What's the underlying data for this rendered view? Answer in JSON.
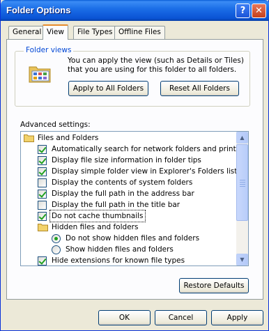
{
  "window": {
    "title": "Folder Options"
  },
  "titlebar": {
    "help_label": "?",
    "close_label": "✕"
  },
  "tabs": [
    {
      "label": "General"
    },
    {
      "label": "View"
    },
    {
      "label": "File Types"
    },
    {
      "label": "Offline Files"
    }
  ],
  "folder_views": {
    "legend": "Folder views",
    "description": "You can apply the view (such as Details or Tiles) that you are using for this folder to all folders.",
    "apply_label": "Apply to All Folders",
    "reset_label": "Reset All Folders"
  },
  "advanced": {
    "label": "Advanced settings:",
    "items": [
      {
        "type": "folder",
        "label": "Files and Folders"
      },
      {
        "type": "checkbox",
        "checked": true,
        "label": "Automatically search for network folders and printers"
      },
      {
        "type": "checkbox",
        "checked": true,
        "label": "Display file size information in folder tips"
      },
      {
        "type": "checkbox",
        "checked": true,
        "label": "Display simple folder view in Explorer's Folders list"
      },
      {
        "type": "checkbox",
        "checked": false,
        "label": "Display the contents of system folders"
      },
      {
        "type": "checkbox",
        "checked": true,
        "label": "Display the full path in the address bar"
      },
      {
        "type": "checkbox",
        "checked": false,
        "label": "Display the full path in the title bar"
      },
      {
        "type": "checkbox",
        "checked": true,
        "label": "Do not cache thumbnails",
        "selected": true
      },
      {
        "type": "folder",
        "label": "Hidden files and folders"
      },
      {
        "type": "radio",
        "checked": true,
        "label": "Do not show hidden files and folders"
      },
      {
        "type": "radio",
        "checked": false,
        "label": "Show hidden files and folders"
      },
      {
        "type": "checkbox",
        "checked": true,
        "label": "Hide extensions for known file types"
      }
    ],
    "restore_label": "Restore Defaults"
  },
  "buttons": {
    "ok": "OK",
    "cancel": "Cancel",
    "apply": "Apply"
  },
  "colors": {
    "title_bar": "#0a53d4",
    "tab_highlight": "#e68b2c",
    "legend": "#0046d5",
    "check": "#21a121"
  }
}
